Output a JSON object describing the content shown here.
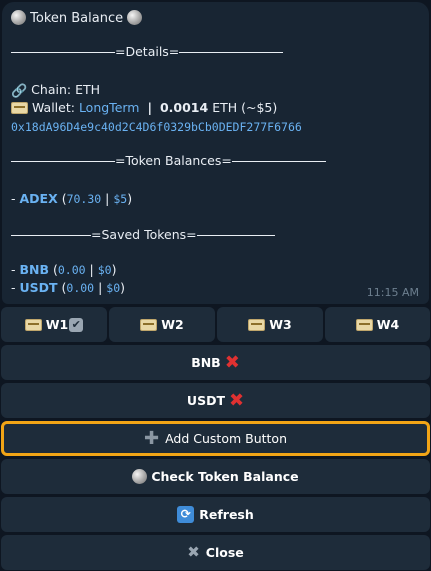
{
  "message": {
    "title": "Token Balance",
    "details_header": "=Details=",
    "chain_label": "Chain:",
    "chain_value": "ETH",
    "wallet_label": "Wallet:",
    "wallet_name": "LongTerm",
    "wallet_divider": "|",
    "wallet_amount": "0.0014",
    "wallet_unit": "ETH (~$5)",
    "address": "0x18dA96D4e9c40d2C4D6f0329bCb0DEDF277F6766",
    "token_balances_header": "=Token Balances=",
    "tokens": [
      {
        "prefix": "- ",
        "symbol": "ADEX",
        "amount": "70.30",
        "usd": "$5"
      }
    ],
    "saved_tokens_header": "=Saved Tokens=",
    "saved_tokens": [
      {
        "prefix": "- ",
        "symbol": "BNB",
        "amount": "0.00",
        "usd": "$0"
      },
      {
        "prefix": "- ",
        "symbol": "USDT",
        "amount": "0.00",
        "usd": "$0"
      }
    ],
    "time": "11:15 AM"
  },
  "keyboard": {
    "wallets": [
      {
        "label": "W1",
        "selected": true
      },
      {
        "label": "W2",
        "selected": false
      },
      {
        "label": "W3",
        "selected": false
      },
      {
        "label": "W4",
        "selected": false
      }
    ],
    "remove_bnb": "BNB",
    "remove_usdt": "USDT",
    "add_custom": "Add Custom Button",
    "check_balance": "Check Token Balance",
    "refresh": "Refresh",
    "close": "Close"
  },
  "colors": {
    "background": "#0e1621",
    "bubble": "#182533",
    "button": "#1e2c3a",
    "link": "#6ab2f2",
    "highlight": "#f2a516",
    "remove": "#e03131"
  }
}
